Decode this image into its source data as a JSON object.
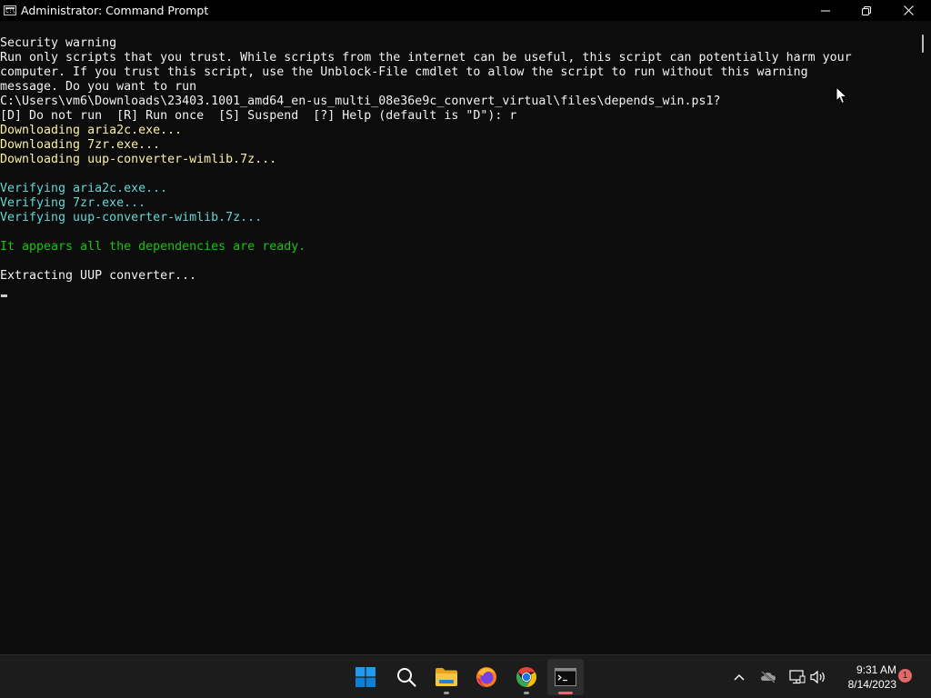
{
  "window": {
    "title": "Administrator: Command Prompt",
    "icon_text": "C:\\"
  },
  "console": {
    "lines": [
      {
        "text": "Security warning",
        "color": "white"
      },
      {
        "text": "Run only scripts that you trust. While scripts from the internet can be useful, this script can potentially harm your",
        "color": "white"
      },
      {
        "text": "computer. If you trust this script, use the Unblock-File cmdlet to allow the script to run without this warning",
        "color": "white"
      },
      {
        "text": "message. Do you want to run",
        "color": "white"
      },
      {
        "text": "C:\\Users\\vm6\\Downloads\\23403.1001_amd64_en-us_multi_08e36e9c_convert_virtual\\files\\depends_win.ps1?",
        "color": "white"
      },
      {
        "text": "[D] Do not run  [R] Run once  [S] Suspend  [?] Help (default is \"D\"): r",
        "color": "white"
      },
      {
        "text": "Downloading aria2c.exe...",
        "color": "yellow"
      },
      {
        "text": "Downloading 7zr.exe...",
        "color": "yellow"
      },
      {
        "text": "Downloading uup-converter-wimlib.7z...",
        "color": "yellow"
      },
      {
        "text": "",
        "color": "white"
      },
      {
        "text": "Verifying aria2c.exe...",
        "color": "cyan"
      },
      {
        "text": "Verifying 7zr.exe...",
        "color": "cyan"
      },
      {
        "text": "Verifying uup-converter-wimlib.7z...",
        "color": "cyan"
      },
      {
        "text": "",
        "color": "white"
      },
      {
        "text": "It appears all the dependencies are ready.",
        "color": "green"
      },
      {
        "text": "",
        "color": "white"
      },
      {
        "text": "Extracting UUP converter...",
        "color": "white"
      }
    ]
  },
  "taskbar": {
    "apps": [
      {
        "name": "start-button",
        "icon": "windows-logo-icon"
      },
      {
        "name": "search-button",
        "icon": "search-icon"
      },
      {
        "name": "file-explorer-button",
        "icon": "folder-icon"
      },
      {
        "name": "firefox-button",
        "icon": "firefox-icon"
      },
      {
        "name": "chrome-button",
        "icon": "chrome-icon"
      },
      {
        "name": "terminal-button",
        "icon": "terminal-icon"
      }
    ],
    "clock_time": "9:31 AM",
    "clock_date": "8/14/2023",
    "notification_count": "1"
  },
  "colors": {
    "console_bg": "#0c0c0c",
    "warning_text": "#f2f2f2",
    "download_text": "#f9f1a5",
    "verify_text": "#61d6d6",
    "ready_text": "#16c60c",
    "taskbar_bg": "#1c1c1c",
    "accent": "#0078d4"
  }
}
